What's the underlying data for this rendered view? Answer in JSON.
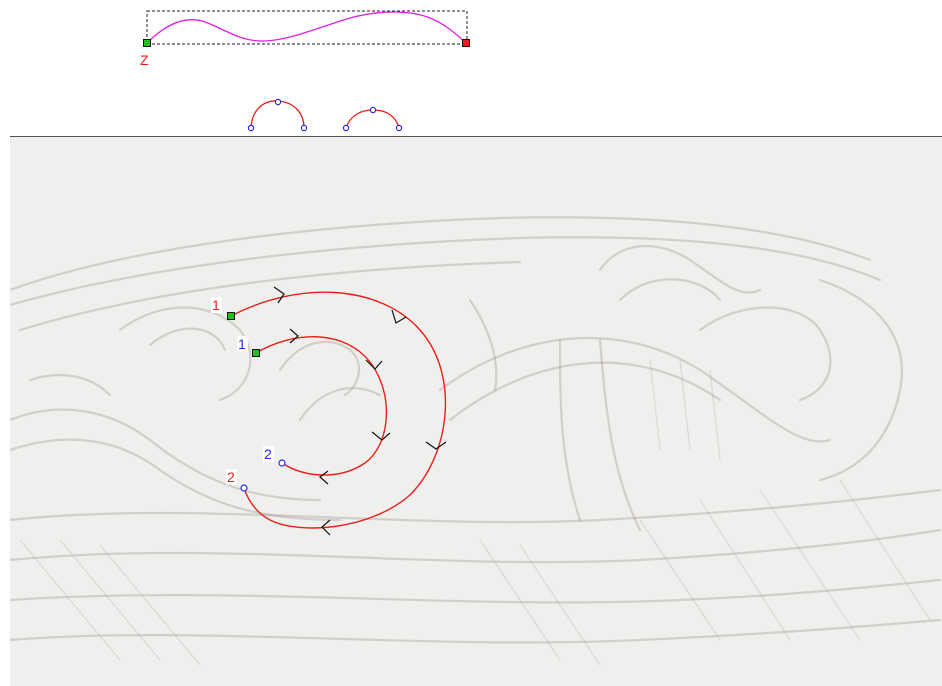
{
  "colors": {
    "path_red": "#e8201a",
    "envelope_magenta": "#e020e0",
    "node_blue": "#2a2ae0",
    "start_green": "#20c020",
    "sketch_brown": "#8a7a74",
    "arrow_black": "#111111"
  },
  "envelope": {
    "label": "Z",
    "start_icon": "green-square-node-icon",
    "end_icon": "red-square-node-icon"
  },
  "profiles": [
    {
      "label": "1",
      "color": "#e8201a"
    },
    {
      "label": "2",
      "color": "#e8201a"
    }
  ],
  "canvas": {
    "outer_path": {
      "start_label": "1",
      "end_label": "2",
      "label_color": "#e8201a"
    },
    "inner_path": {
      "start_label": "1",
      "end_label": "2",
      "label_color": "#2a2ae0"
    },
    "direction_icon": "direction-arrow-icon"
  }
}
